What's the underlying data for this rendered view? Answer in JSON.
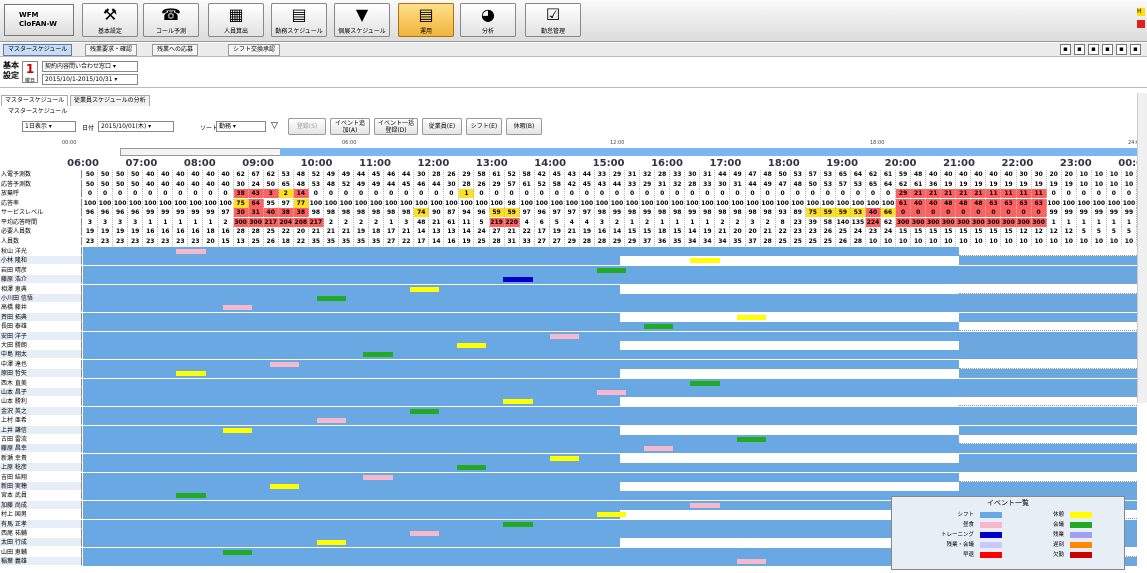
{
  "toolbar": {
    "logo_line1": "WFM",
    "logo_line2": "CloFAN-W",
    "buttons": [
      {
        "label": "基本設定",
        "icon": "tools-icon"
      },
      {
        "label": "コール予測",
        "icon": "phone-icon"
      },
      {
        "label": "人員算出",
        "icon": "calculator-icon"
      },
      {
        "label": "勤務スケジュール",
        "icon": "schedule-icon"
      },
      {
        "label": "個展スケジュール",
        "icon": "person-schedule-icon"
      },
      {
        "label": "運用",
        "icon": "operation-icon"
      },
      {
        "label": "分析",
        "icon": "pie-chart-icon"
      },
      {
        "label": "勤怠管理",
        "icon": "checkbox-icon"
      }
    ],
    "active": "運用"
  },
  "tabs2": [
    "マスタースケジュール",
    "残業要求・確認",
    "残業への応募",
    "シフト交換承認"
  ],
  "basic": {
    "label": "基本設定",
    "day_num": "1",
    "day_sub": "曜日",
    "select1": "契約内容問い合わせ窓口",
    "select2": "2015/10/1-2015/10/31"
  },
  "subtabs": [
    "マスタースケジュール",
    "従業員スケジュールの分析"
  ],
  "sublabel": "マスタースケジュール",
  "controls": {
    "view": "1日表示",
    "date_label": "日付",
    "date": "2015/10/01(木)",
    "sort_label": "ソート",
    "sort": "勤務",
    "buttons": [
      "登録(S)",
      "イベント追加(A)",
      "イベント一括登録(D)",
      "従業員(E)",
      "シフト(E)",
      "休暇(B)"
    ]
  },
  "ruler": [
    "00:00",
    "06:00",
    "12:00",
    "18:00",
    "24:00"
  ],
  "hours": [
    "06:00",
    "07:00",
    "08:00",
    "09:00",
    "10:00",
    "11:00",
    "12:00",
    "13:00",
    "14:00",
    "15:00",
    "16:00",
    "17:00",
    "18:00",
    "19:00",
    "20:00",
    "21:00",
    "22:00",
    "23:00",
    "00:00"
  ],
  "stats": [
    {
      "label": "入電予測数",
      "values": [
        "50",
        "50",
        "50",
        "50",
        "40",
        "40",
        "40",
        "40",
        "40",
        "40",
        "62",
        "67",
        "62",
        "53",
        "48",
        "52",
        "49",
        "49",
        "44",
        "45",
        "46",
        "44",
        "30",
        "28",
        "26",
        "29",
        "58",
        "61",
        "52",
        "58",
        "42",
        "45",
        "43",
        "44",
        "33",
        "29",
        "31",
        "32",
        "28",
        "33",
        "30",
        "31",
        "44",
        "49",
        "47",
        "48",
        "50",
        "53",
        "57",
        "53",
        "65",
        "64",
        "62",
        "61",
        "59",
        "48",
        "40",
        "40",
        "40",
        "40",
        "40",
        "40",
        "30",
        "30",
        "20",
        "20",
        "10",
        "10",
        "10",
        "10"
      ]
    },
    {
      "label": "応答予測数",
      "values": [
        "50",
        "50",
        "50",
        "50",
        "40",
        "40",
        "40",
        "40",
        "40",
        "40",
        "30",
        "24",
        "50",
        "65",
        "48",
        "53",
        "48",
        "52",
        "49",
        "49",
        "44",
        "45",
        "46",
        "44",
        "30",
        "28",
        "26",
        "29",
        "57",
        "61",
        "52",
        "58",
        "42",
        "45",
        "43",
        "44",
        "33",
        "29",
        "31",
        "32",
        "28",
        "33",
        "30",
        "31",
        "44",
        "49",
        "47",
        "48",
        "50",
        "53",
        "57",
        "53",
        "65",
        "64",
        "62",
        "61",
        "36",
        "19",
        "19",
        "19",
        "19",
        "19",
        "19",
        "19",
        "19",
        "19",
        "10",
        "10",
        "10",
        "10"
      ]
    },
    {
      "label": "放棄呼",
      "values": [
        "0",
        "0",
        "0",
        "0",
        "0",
        "0",
        "0",
        "0",
        "0",
        "0",
        "38",
        "43",
        "3",
        "2",
        "14",
        "0",
        "0",
        "0",
        "0",
        "0",
        "0",
        "0",
        "0",
        "0",
        "0",
        "1",
        "0",
        "0",
        "0",
        "0",
        "0",
        "0",
        "0",
        "0",
        "0",
        "0",
        "0",
        "0",
        "0",
        "0",
        "0",
        "0",
        "0",
        "0",
        "0",
        "0",
        "0",
        "0",
        "0",
        "0",
        "0",
        "0",
        "0",
        "0",
        "29",
        "21",
        "21",
        "21",
        "21",
        "21",
        "11",
        "11",
        "11",
        "11",
        "0",
        "0",
        "0",
        "0",
        "0",
        "0"
      ]
    },
    {
      "label": "応答率",
      "values": [
        "100",
        "100",
        "100",
        "100",
        "100",
        "100",
        "100",
        "100",
        "100",
        "100",
        "75",
        "64",
        "95",
        "97",
        "77",
        "100",
        "100",
        "100",
        "100",
        "100",
        "100",
        "100",
        "100",
        "100",
        "100",
        "100",
        "100",
        "100",
        "98",
        "100",
        "100",
        "100",
        "100",
        "100",
        "100",
        "100",
        "100",
        "100",
        "100",
        "100",
        "100",
        "100",
        "100",
        "100",
        "100",
        "100",
        "100",
        "100",
        "100",
        "100",
        "100",
        "100",
        "100",
        "100",
        "61",
        "40",
        "40",
        "48",
        "48",
        "48",
        "63",
        "63",
        "63",
        "63",
        "100",
        "100",
        "100",
        "100",
        "100",
        "100"
      ]
    },
    {
      "label": "サービスレベル",
      "values": [
        "96",
        "96",
        "96",
        "96",
        "99",
        "99",
        "99",
        "99",
        "99",
        "97",
        "30",
        "31",
        "40",
        "38",
        "38",
        "98",
        "98",
        "98",
        "98",
        "98",
        "98",
        "98",
        "74",
        "90",
        "87",
        "94",
        "96",
        "59",
        "59",
        "97",
        "96",
        "97",
        "97",
        "97",
        "98",
        "99",
        "98",
        "99",
        "98",
        "98",
        "99",
        "98",
        "98",
        "98",
        "98",
        "98",
        "93",
        "89",
        "75",
        "59",
        "59",
        "53",
        "40",
        "66",
        "0",
        "0",
        "0",
        "0",
        "0",
        "0",
        "0",
        "0",
        "0",
        "0",
        "99",
        "99",
        "99",
        "99",
        "99",
        "99"
      ]
    },
    {
      "label": "平均応答時間",
      "values": [
        "3",
        "3",
        "3",
        "3",
        "1",
        "1",
        "1",
        "1",
        "1",
        "2",
        "300",
        "300",
        "217",
        "204",
        "208",
        "217",
        "2",
        "2",
        "2",
        "2",
        "1",
        "3",
        "48",
        "21",
        "61",
        "11",
        "5",
        "219",
        "220",
        "4",
        "6",
        "5",
        "4",
        "4",
        "3",
        "2",
        "1",
        "2",
        "1",
        "1",
        "1",
        "1",
        "2",
        "2",
        "3",
        "2",
        "8",
        "23",
        "39",
        "58",
        "140",
        "135",
        "224",
        "62",
        "300",
        "300",
        "300",
        "300",
        "300",
        "300",
        "300",
        "300",
        "300",
        "300",
        "1",
        "1",
        "1",
        "1",
        "1",
        "1"
      ]
    },
    {
      "label": "必要人員数",
      "values": [
        "19",
        "19",
        "19",
        "19",
        "16",
        "16",
        "16",
        "16",
        "18",
        "16",
        "28",
        "28",
        "25",
        "22",
        "20",
        "21",
        "21",
        "21",
        "19",
        "18",
        "17",
        "21",
        "14",
        "13",
        "13",
        "14",
        "24",
        "27",
        "21",
        "22",
        "17",
        "19",
        "21",
        "19",
        "16",
        "14",
        "15",
        "15",
        "18",
        "15",
        "14",
        "19",
        "21",
        "20",
        "20",
        "21",
        "22",
        "23",
        "23",
        "26",
        "25",
        "24",
        "23",
        "24",
        "15",
        "15",
        "15",
        "15",
        "15",
        "15",
        "15",
        "15",
        "12",
        "12",
        "12",
        "12",
        "5",
        "5",
        "5",
        "5"
      ]
    },
    {
      "label": "人員数",
      "values": [
        "23",
        "23",
        "23",
        "23",
        "23",
        "23",
        "23",
        "23",
        "20",
        "15",
        "13",
        "25",
        "26",
        "18",
        "22",
        "35",
        "35",
        "35",
        "35",
        "35",
        "27",
        "22",
        "17",
        "14",
        "16",
        "19",
        "25",
        "28",
        "31",
        "33",
        "27",
        "27",
        "29",
        "28",
        "28",
        "29",
        "29",
        "37",
        "36",
        "35",
        "34",
        "34",
        "34",
        "35",
        "37",
        "28",
        "25",
        "25",
        "25",
        "25",
        "26",
        "28",
        "10",
        "10",
        "10",
        "10",
        "10",
        "10",
        "10",
        "10",
        "10",
        "10",
        "10",
        "10",
        "10",
        "10",
        "10",
        "10",
        "10",
        "10"
      ]
    }
  ],
  "staff": [
    "秋山 洋光",
    "小林 隆和",
    "岩田 晴彦",
    "藤原 浩介",
    "相澤 恵典",
    "小川田 信悟",
    "高橋 藤井",
    "斉田 拓典",
    "長田 泰雄",
    "安田 洋子",
    "大田 勝朗",
    "中島 翔太",
    "中澤 達也",
    "原田 哲矢",
    "西木 直美",
    "山本 昌子",
    "山本 勝利",
    "金沢 英之",
    "上村 亜希",
    "上井 謙信",
    "古田 雷流",
    "藤原 昌幸",
    "新瀬 幸貴",
    "上原 稔彦",
    "吉田 結翔",
    "新田 実穂",
    "宮本 武員",
    "加藤 尚成",
    "村上 国男",
    "有馬 正孝",
    "西尾 祐輔",
    "太田 行成",
    "山田 恵輔",
    "稲葉 義雄"
  ],
  "legend": {
    "title": "イベント一覧",
    "items": [
      {
        "label": "シフト",
        "color": "#6aa8e4"
      },
      {
        "label": "休憩",
        "color": "#ffff00"
      },
      {
        "label": "昼食",
        "color": "#f8b8cc"
      },
      {
        "label": "会議",
        "color": "#22aa22"
      },
      {
        "label": "トレーニング",
        "color": "#0000cc"
      },
      {
        "label": "残業",
        "color": "#a0a0f0"
      },
      {
        "label": "残業・会議",
        "color": "#c8c8ff"
      },
      {
        "label": "遅刻",
        "color": "#ff8800"
      },
      {
        "label": "早退",
        "color": "#ff0000"
      },
      {
        "label": "欠勤",
        "color": "#cc0000"
      }
    ]
  },
  "colors": {
    "shift": "#6aa8e4",
    "break": "#ffff00",
    "lunch": "#f8b8cc",
    "meeting": "#22aa22",
    "training": "#0000cc",
    "alert": "#ff6060",
    "warn": "#ffe020"
  }
}
